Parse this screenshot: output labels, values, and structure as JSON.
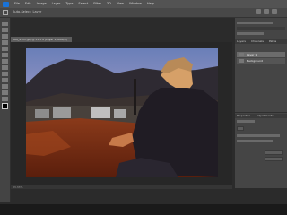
{
  "menu": {
    "items": [
      "File",
      "Edit",
      "Image",
      "Layer",
      "Type",
      "Select",
      "Filter",
      "3D",
      "View",
      "Window",
      "Help"
    ]
  },
  "options": {
    "text": "Auto-Select: Layer"
  },
  "document": {
    "tab_title": "IMG_4321.jpg @ 33.3% (Layer 1, RGB/8)"
  },
  "status": {
    "zoom": "33.33%"
  },
  "panels": {
    "tab1": "Layers",
    "tab2": "Channels",
    "tab3": "Paths",
    "layers": [
      "Layer 1",
      "Background"
    ],
    "properties_tabs": [
      "Properties",
      "Adjustments"
    ]
  },
  "colors": {
    "accent": "#1a73d9",
    "panel": "#454545",
    "background": "#2b2b2b"
  }
}
